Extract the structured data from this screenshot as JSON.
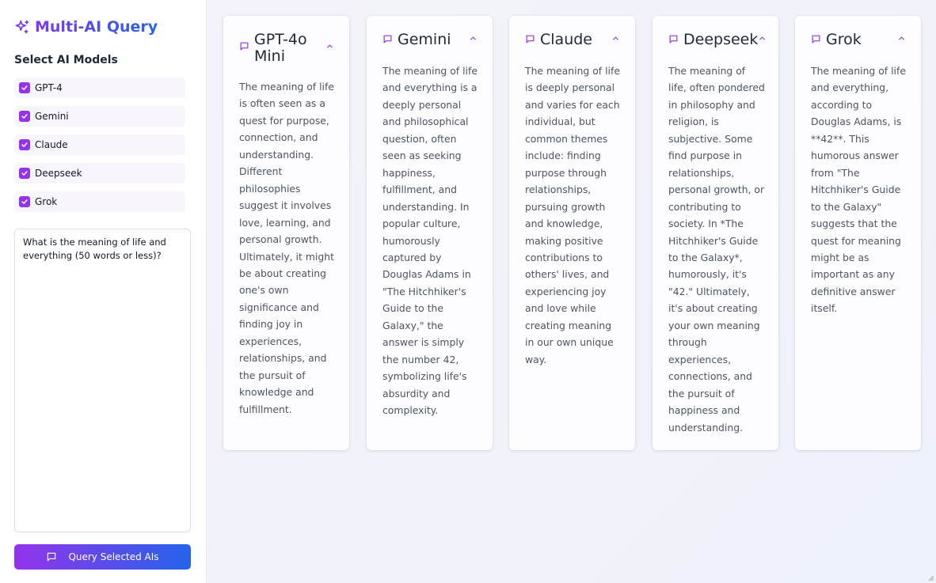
{
  "app": {
    "title": "Multi-AI Query",
    "brand_colors": [
      "#7c3aed",
      "#2563eb"
    ]
  },
  "sidebar": {
    "section_title": "Select AI Models",
    "models": [
      {
        "label": "GPT-4",
        "checked": true
      },
      {
        "label": "Gemini",
        "checked": true
      },
      {
        "label": "Claude",
        "checked": true
      },
      {
        "label": "Deepseek",
        "checked": true
      },
      {
        "label": "Grok",
        "checked": true
      }
    ],
    "prompt_value": "What is the meaning of life and everything (50 words or less)?",
    "query_button_label": "Query Selected AIs"
  },
  "responses": [
    {
      "title": "GPT-4o Mini",
      "icon": "message-square-icon",
      "text": "The meaning of life is often seen as a quest for purpose, connection, and understanding. Different philosophies suggest it involves love, learning, and personal growth. Ultimately, it might be about creating one's own significance and finding joy in experiences, relationships, and the pursuit of knowledge and fulfillment."
    },
    {
      "title": "Gemini",
      "icon": "message-square-icon",
      "text": "The meaning of life and everything is a deeply personal and philosophical question, often seen as seeking happiness, fulfillment, and understanding. In popular culture, humorously captured by Douglas Adams in \"The Hitchhiker's Guide to the Galaxy,\" the answer is simply the number 42, symbolizing life's absurdity and complexity."
    },
    {
      "title": "Claude",
      "icon": "message-square-icon",
      "text": "The meaning of life is deeply personal and varies for each individual, but common themes include: finding purpose through relationships, pursuing growth and knowledge, making positive contributions to others' lives, and experiencing joy and love while creating meaning in our own unique way."
    },
    {
      "title": "Deepseek",
      "icon": "message-square-icon",
      "text": "The meaning of life, often pondered in philosophy and religion, is subjective. Some find purpose in relationships, personal growth, or contributing to society. In *The Hitchhiker's Guide to the Galaxy*, humorously, it's \"42.\" Ultimately, it's about creating your own meaning through experiences, connections, and the pursuit of happiness and understanding."
    },
    {
      "title": "Grok",
      "icon": "message-square-icon",
      "text": "The meaning of life and everything, according to Douglas Adams, is **42**. This humorous answer from \"The Hitchhiker's Guide to the Galaxy\" suggests that the quest for meaning might be as important as any definitive answer itself."
    }
  ]
}
